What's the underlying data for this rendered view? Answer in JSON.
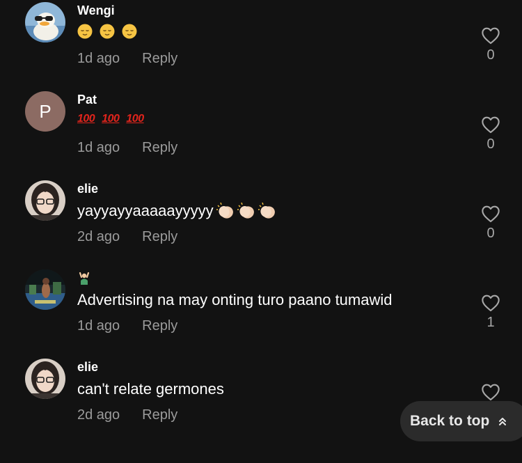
{
  "comments": [
    {
      "username": "Wengi",
      "avatar_icon": "duck-avatar-icon",
      "body_emojis": [
        "relieved-face",
        "relieved-face",
        "relieved-face"
      ],
      "time": "1d ago",
      "reply": "Reply",
      "likes": "0"
    },
    {
      "username": "Pat",
      "avatar_letter": "P",
      "body_emojis": [
        "hundred-points",
        "hundred-points",
        "hundred-points"
      ],
      "hundred_text": "100",
      "time": "1d ago",
      "reply": "Reply",
      "likes": "0"
    },
    {
      "username": "elie",
      "avatar_icon": "photo-avatar-icon",
      "text": "yayyayyaaaaayyyyy",
      "body_emojis": [
        "clapping-hands",
        "clapping-hands",
        "clapping-hands"
      ],
      "time": "2d ago",
      "reply": "Reply",
      "likes": "0"
    },
    {
      "username": "",
      "username_emoji": "person-gesturing-icon",
      "avatar_icon": "photo-avatar-icon",
      "text": "Advertising na may onting turo paano tumawid",
      "time": "1d ago",
      "reply": "Reply",
      "likes": "1"
    },
    {
      "username": "elie",
      "avatar_icon": "photo-avatar-icon",
      "text": "can't relate germones",
      "time": "2d ago",
      "reply": "Reply",
      "likes": ""
    }
  ],
  "back_to_top": {
    "label": "Back to top",
    "icon": "double-chevron-up-icon"
  },
  "colors": {
    "background": "#121212",
    "muted_text": "#9b9b9b",
    "hundred_red": "#e0241c",
    "pill_bg": "#2b2b2b"
  }
}
